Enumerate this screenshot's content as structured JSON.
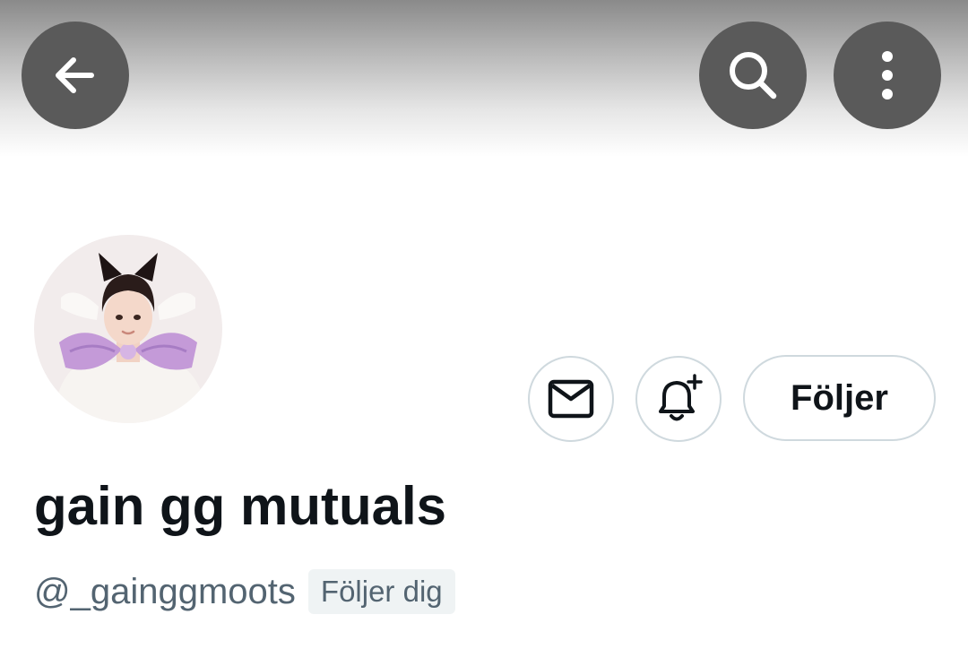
{
  "header": {
    "back_icon": "arrow-left-icon",
    "search_icon": "search-icon",
    "more_icon": "more-vertical-icon"
  },
  "profile": {
    "display_name": "gain gg mutuals",
    "handle": "@_gainggmoots",
    "follows_you_badge": "Följer dig"
  },
  "actions": {
    "message_icon": "mail-icon",
    "notify_icon": "bell-plus-icon",
    "follow_label": "Följer"
  },
  "colors": {
    "text_primary": "#0f1419",
    "text_secondary": "#536471",
    "button_border": "#cfd9de",
    "header_button_bg": "#5a5a5a",
    "badge_bg": "#eff3f4"
  }
}
